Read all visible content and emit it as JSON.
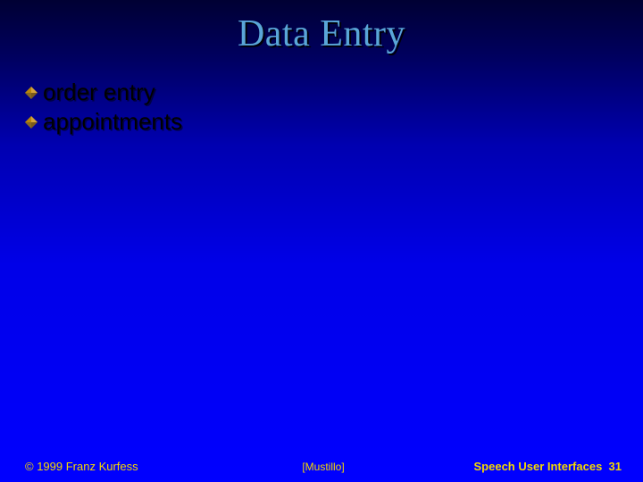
{
  "slide": {
    "title": "Data Entry",
    "bullets": [
      {
        "text": "order entry"
      },
      {
        "text": "appointments"
      }
    ],
    "footer": {
      "copyright": "© 1999 Franz Kurfess",
      "citation": "[Mustillo]",
      "series": "Speech User Interfaces",
      "page": "31"
    },
    "colors": {
      "title": "#5aa6d8",
      "bullet_icon": "#b8860b",
      "footer_text": "#f5d800"
    }
  }
}
